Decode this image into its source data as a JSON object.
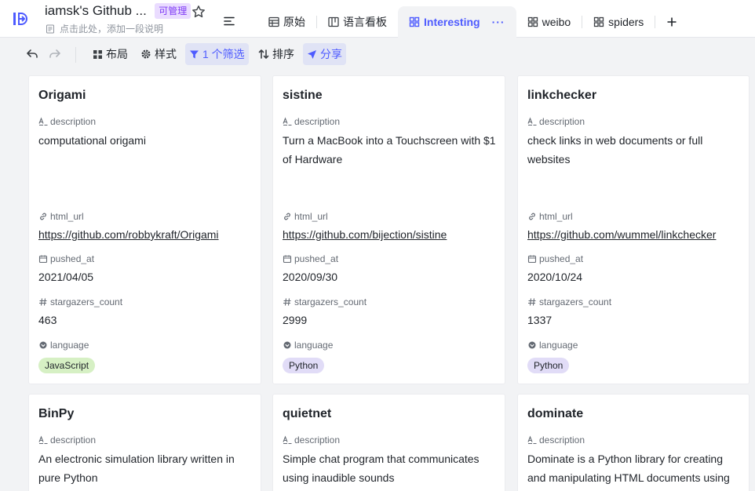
{
  "header": {
    "base_title": "iamsk's Github ...",
    "permission_badge": "可管理",
    "description_placeholder": "点击此处，添加一段说明",
    "tabs": [
      {
        "label": "原始",
        "icon": "grid-table-icon",
        "active": false
      },
      {
        "label": "语言看板",
        "icon": "kanban-icon",
        "active": false
      },
      {
        "label": "Interesting",
        "icon": "gallery-icon",
        "active": true,
        "more": "···"
      },
      {
        "label": "weibo",
        "icon": "gallery-icon",
        "active": false
      },
      {
        "label": "spiders",
        "icon": "gallery-icon",
        "active": false
      }
    ],
    "add_tab_label": "+"
  },
  "toolbar": {
    "layout": "布局",
    "style": "样式",
    "filter": "1 个筛选",
    "sort": "排序",
    "share": "分享"
  },
  "field_labels": {
    "description": "description",
    "html_url": "html_url",
    "pushed_at": "pushed_at",
    "stargazers_count": "stargazers_count",
    "language": "language"
  },
  "cards": [
    {
      "title": "Origami",
      "description": "computational origami",
      "html_url": "https://github.com/robbykraft/Origami",
      "pushed_at": "2021/04/05",
      "stargazers_count": "463",
      "language": "JavaScript"
    },
    {
      "title": "sistine",
      "description": "Turn a MacBook into a Touchscreen with $1 of Hardware",
      "html_url": "https://github.com/bijection/sistine",
      "pushed_at": "2020/09/30",
      "stargazers_count": "2999",
      "language": "Python"
    },
    {
      "title": "linkchecker",
      "description": "check links in web documents or full websites",
      "html_url": "https://github.com/wummel/linkchecker",
      "pushed_at": "2020/10/24",
      "stargazers_count": "1337",
      "language": "Python"
    },
    {
      "title": "BinPy",
      "description": "An electronic simulation library written in pure Python"
    },
    {
      "title": "quietnet",
      "description": "Simple chat program that communicates using inaudible sounds"
    },
    {
      "title": "dominate",
      "description": "Dominate is a Python library for creating and manipulating HTML documents using"
    }
  ],
  "colors": {
    "accent": "#4e5bff",
    "badge_bg": "#eadcff",
    "javascript_tag": "#d6f0c4",
    "python_tag": "#e1dcf7"
  }
}
